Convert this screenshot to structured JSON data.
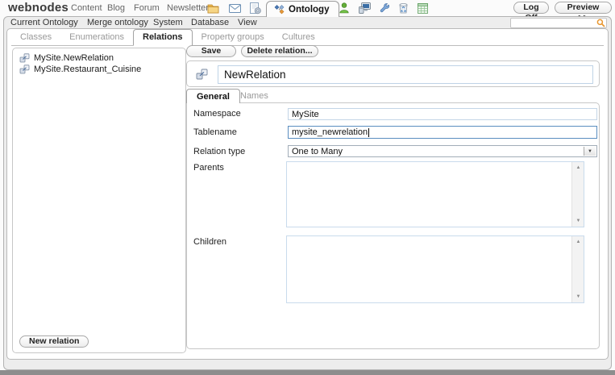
{
  "header": {
    "logo": "webnodes",
    "menu_items": [
      "Content",
      "Blog",
      "Forum",
      "Newsletter"
    ],
    "active_tab": "Ontology",
    "log_off_label": "Log Off",
    "preview_label": "Preview >>"
  },
  "menubar": {
    "items": [
      "Current Ontology",
      "Merge ontology",
      "System",
      "Database",
      "View"
    ],
    "search": {
      "value": "",
      "placeholder": ""
    }
  },
  "tabs": {
    "items": [
      "Classes",
      "Enumerations",
      "Relations",
      "Property groups",
      "Cultures"
    ],
    "active": "Relations"
  },
  "tree": {
    "items": [
      "MySite.NewRelation",
      "MySite.Restaurant_Cuisine"
    ],
    "new_relation_label": "New relation"
  },
  "editor": {
    "save_label": "Save",
    "delete_label": "Delete relation...",
    "name_value": "NewRelation",
    "detail_tabs": [
      "General",
      "Names"
    ],
    "active_detail_tab": "General",
    "fields": {
      "namespace_label": "Namespace",
      "namespace_value": "MySite",
      "tablename_label": "Tablename",
      "tablename_value": "mysite_newrelation",
      "relation_type_label": "Relation type",
      "relation_type_value": "One to Many",
      "parents_label": "Parents",
      "children_label": "Children"
    }
  },
  "colors": {
    "focus_border": "#5b8ec0",
    "input_border": "#c3d5e6",
    "search_icon": "#e8962e",
    "ontology_icon_blue": "#4a7ab5",
    "ontology_icon_orange": "#e89a3c",
    "footer_bar": "#8d8d8d"
  }
}
